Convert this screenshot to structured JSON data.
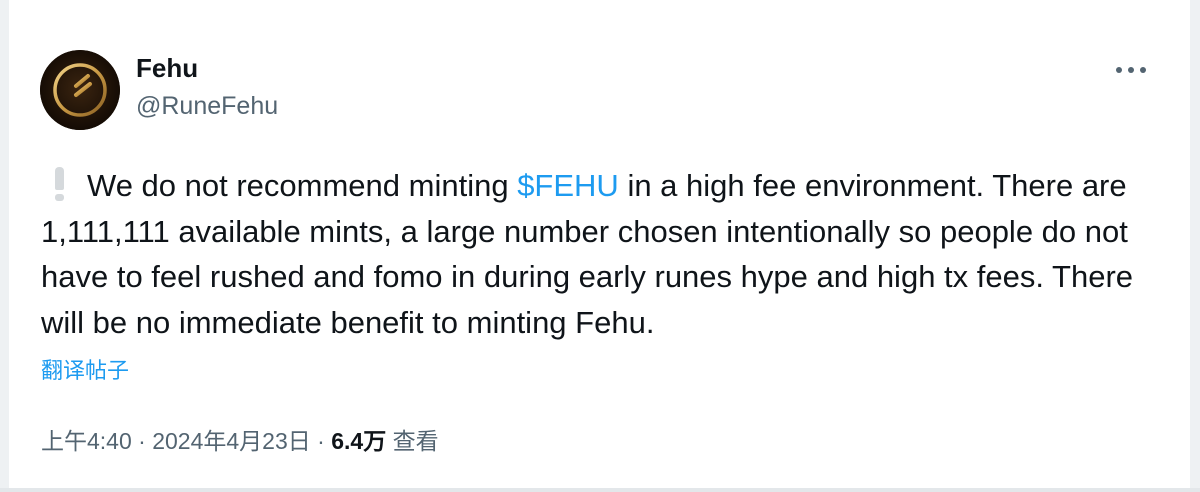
{
  "author": {
    "display_name": "Fehu",
    "handle": "@RuneFehu"
  },
  "icons": {
    "avatar": "fehu-rune-logo",
    "menu": "more-horizontal-icon",
    "notice": "white-exclamation-icon"
  },
  "tweet": {
    "text_before": "We do not recommend minting ",
    "cashtag": "$FEHU",
    "text_after": " in a high fee environment. There are 1,111,111 available mints, a large number chosen intentionally so people do not have to feel rushed and fomo in during early runes hype and high tx fees. There will be no immediate benefit to minting Fehu."
  },
  "translate_label": "翻译帖子",
  "meta": {
    "time": "上午4:40",
    "separator": "·",
    "date": "2024年4月23日",
    "views_count": "6.4万",
    "views_label": "查看"
  },
  "colors": {
    "link": "#1d9bf0",
    "secondary_text": "#536471",
    "primary_text": "#0f1419"
  }
}
